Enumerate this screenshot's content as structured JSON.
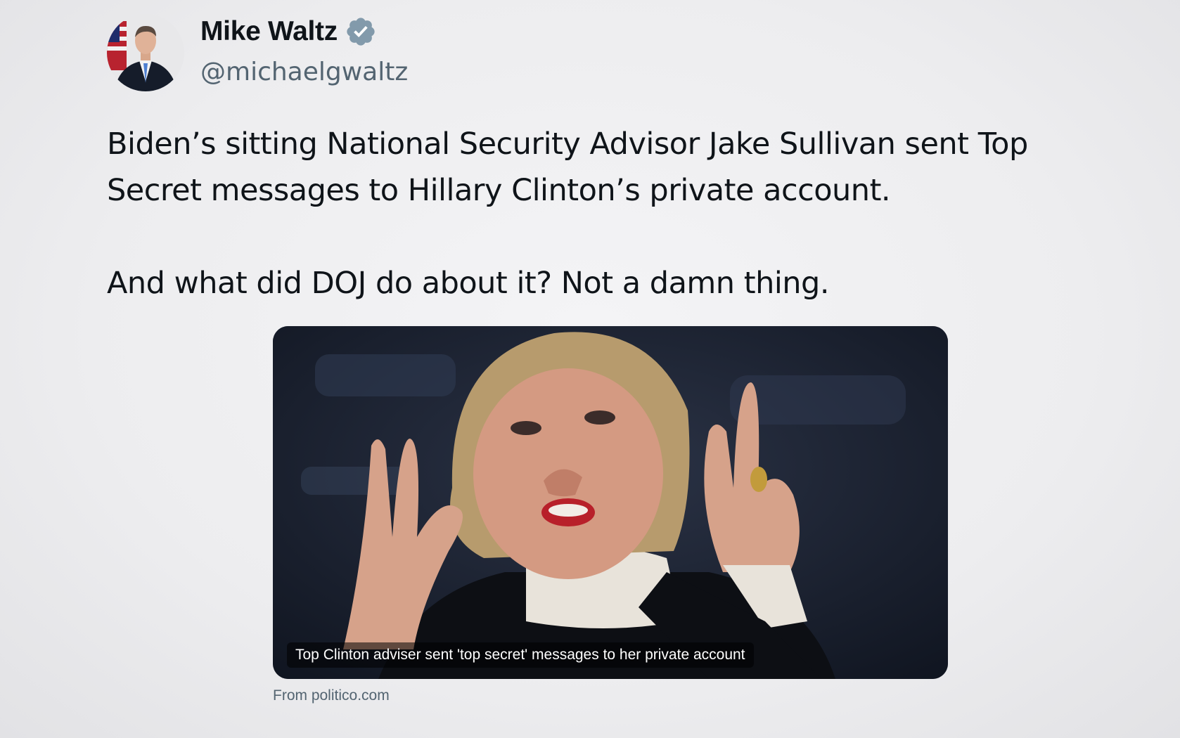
{
  "author": {
    "display_name": "Mike Waltz",
    "handle": "@michaelgwaltz",
    "verified": true,
    "verified_icon": "verified-badge-icon",
    "verified_color": "#829aab",
    "avatar_icon": "profile-photo"
  },
  "tweet": {
    "paragraphs": [
      "Biden’s sitting National Security Advisor Jake Sullivan sent Top Secret messages to Hillary Clinton’s private account.",
      "And what did DOJ do about it? Not a damn thing."
    ]
  },
  "link_card": {
    "caption": "Top Clinton adviser sent 'top secret' messages to her private account",
    "source": "From politico.com",
    "image": "news-photo"
  },
  "colors": {
    "text": "#0f1419",
    "secondary": "#536471",
    "background": "#eeeef0"
  }
}
